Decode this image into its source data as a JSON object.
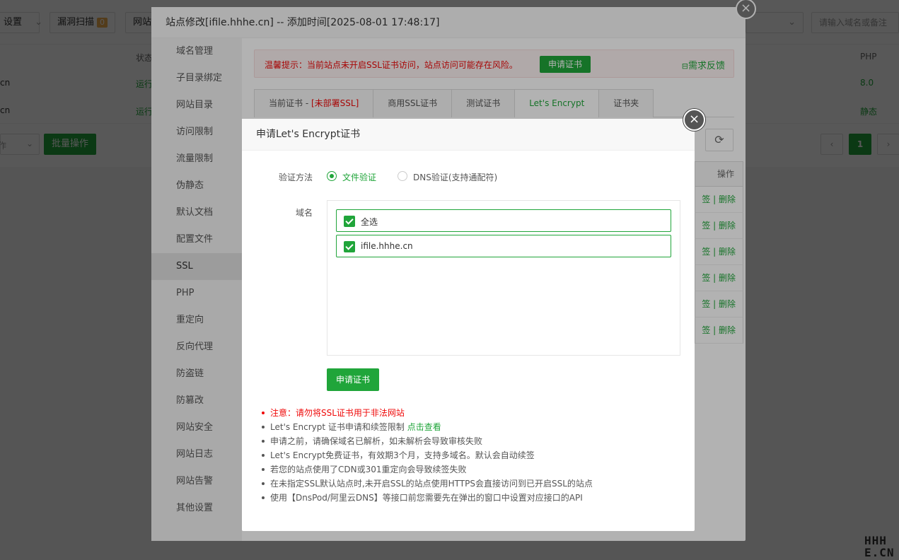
{
  "background": {
    "toolbar": {
      "settings_label": "设置",
      "scan_label": "漏洞扫描",
      "scan_count": "0",
      "site_label": "网站",
      "search_placeholder": "请输入域名或备注"
    },
    "table": {
      "col_status": "状态",
      "col_php": "PHP",
      "rows": [
        {
          "name": "cn",
          "status": "运行",
          "php": "8.0"
        },
        {
          "name": "cn",
          "status": "运行",
          "php": "静态"
        }
      ]
    },
    "footer": {
      "batch_label": "批量操作",
      "select_value": "作",
      "prev": "‹",
      "current_page": "1",
      "next": "›"
    }
  },
  "outer_dialog": {
    "title": "站点修改[ifile.hhhe.cn] -- 添加时间[2025-08-01 17:48:17]",
    "close": "×",
    "nav": [
      "域名管理",
      "子目录绑定",
      "网站目录",
      "访问限制",
      "流量限制",
      "伪静态",
      "默认文档",
      "配置文件",
      "SSL",
      "PHP",
      "重定向",
      "反向代理",
      "防盗链",
      "防篡改",
      "网站安全",
      "网站日志",
      "网站告警",
      "其他设置"
    ],
    "active_nav": "SSL",
    "tip": {
      "text": "温馨提示：当前站点未开启SSL证书访问，站点访问可能存在风险。",
      "button": "申请证书",
      "feedback": "需求反馈"
    },
    "tabs": [
      {
        "label": "当前证书 - ",
        "extra": "[未部署SSL]"
      },
      {
        "label": "商用SSL证书",
        "extra": ""
      },
      {
        "label": "测试证书",
        "extra": ""
      },
      {
        "label": "Let's Encrypt",
        "extra": ""
      },
      {
        "label": "证书夹",
        "extra": ""
      }
    ],
    "refresh": "⟳",
    "cert_table": {
      "col_action": "操作",
      "rows": [
        "签 | 删除",
        "签 | 删除",
        "签 | 删除",
        "签 | 删除",
        "签 | 删除",
        "签 | 删除"
      ]
    }
  },
  "inner_dialog": {
    "title": "申请Let's Encrypt证书",
    "close": "×",
    "verify_label": "验证方法",
    "verify_options": [
      {
        "label": "文件验证",
        "checked": true
      },
      {
        "label": "DNS验证(支持通配符)",
        "checked": false
      }
    ],
    "domain_label": "域名",
    "domains": [
      {
        "label": "全选",
        "checked": true
      },
      {
        "label": "ifile.hhhe.cn",
        "checked": true
      }
    ],
    "apply_button": "申请证书",
    "notes": {
      "n1": "注意：请勿将SSL证书用于非法网站",
      "n2_prefix": "Let's Encrypt 证书申请和续签限制 ",
      "n2_link": "点击查看",
      "n3": "申请之前，请确保域名已解析，如未解析会导致审核失败",
      "n4": "Let's Encrypt免费证书，有效期3个月，支持多域名。默认会自动续签",
      "n5": "若您的站点使用了CDN或301重定向会导致续签失败",
      "n6": "在未指定SSL默认站点时,未开启SSL的站点使用HTTPS会直接访问到已开启SSL的站点",
      "n7": "使用【DnsPod/阿里云DNS】等接口前您需要先在弹出的窗口中设置对应接口的API"
    }
  },
  "watermark": {
    "line1": "HHH",
    "line2": "E.CN"
  },
  "colors": {
    "accent": "#20a53a",
    "danger": "#ef0808"
  }
}
